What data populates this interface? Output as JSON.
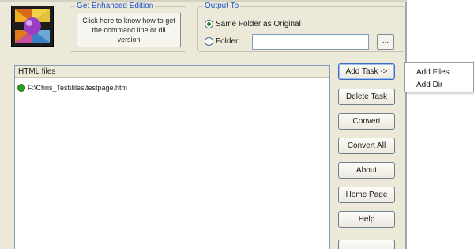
{
  "enhanced": {
    "group_title": "Get Enhanced Edition",
    "button_label": "Click here to know how to get the command line or dll version"
  },
  "output": {
    "group_title": "Output To",
    "option_same": "Same Folder as Original",
    "option_folder": "Folder:",
    "folder_value": "",
    "browse_label": "..."
  },
  "file_list": {
    "header": "HTML files",
    "rows": [
      {
        "path": "F:\\Chris_Test\\files\\testpage.htm",
        "status_icon": "status-ok-icon"
      }
    ]
  },
  "buttons": {
    "add_task": "Add Task ->",
    "delete_task": "Delete Task",
    "convert": "Convert",
    "convert_all": "Convert All",
    "about": "About",
    "home_page": "Home Page",
    "help": "Help"
  },
  "add_menu": {
    "items": [
      "Add Files",
      "Add Dir"
    ]
  },
  "colors": {
    "window_bg": "#ece9d8",
    "group_title": "#1d54c8",
    "status_ok": "#2f9a2a"
  },
  "icons": {
    "app_logo": "app-logo-icon"
  }
}
